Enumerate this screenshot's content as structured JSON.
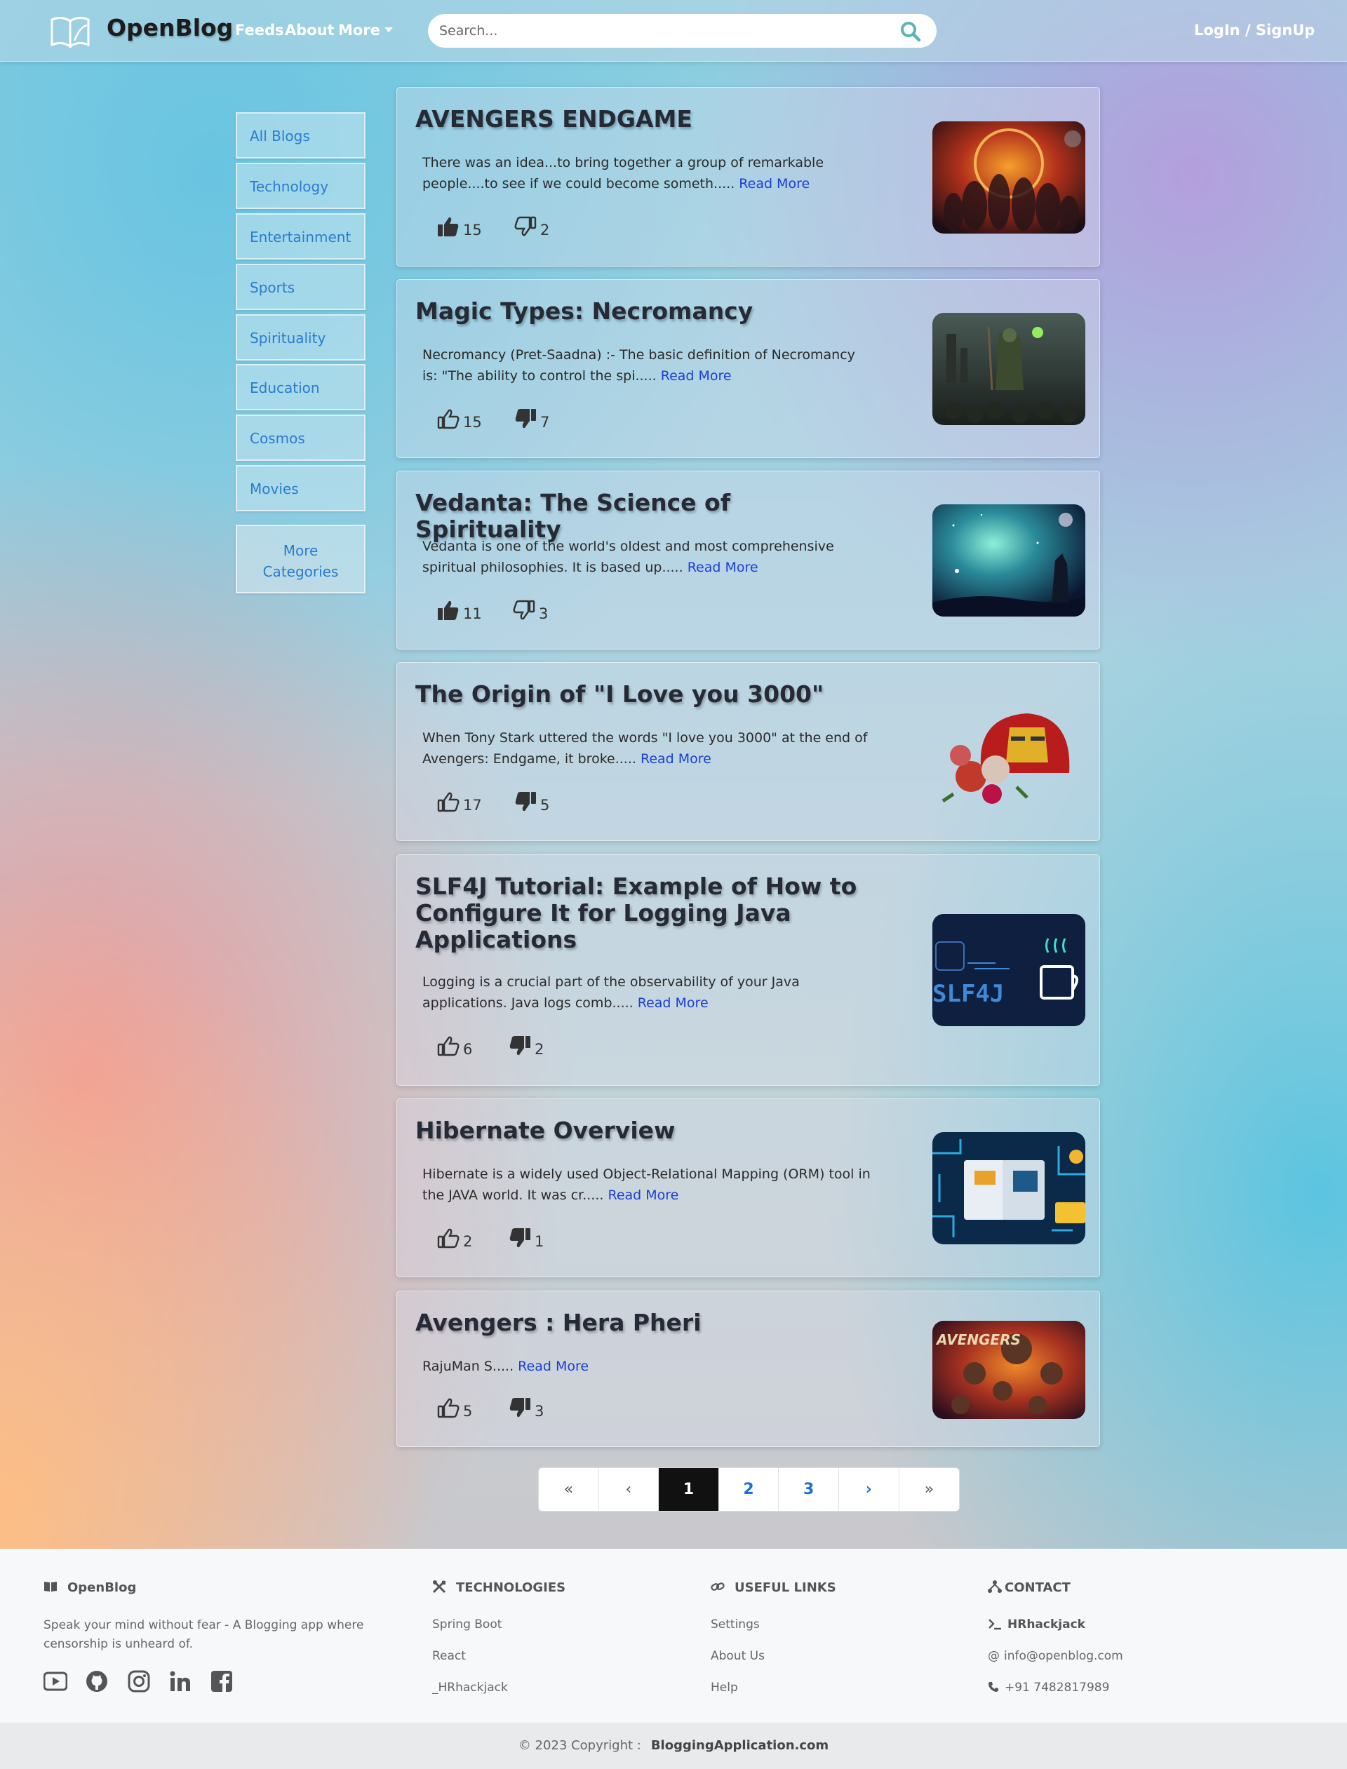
{
  "navbar": {
    "brand": "OpenBlog",
    "links": [
      "Feeds",
      "About",
      "More"
    ],
    "search_placeholder": "Search...",
    "login": "LogIn / SignUp"
  },
  "sidebar": {
    "categories": [
      "All Blogs",
      "Technology",
      "Entertainment",
      "Sports",
      "Spirituality",
      "Education",
      "Cosmos",
      "Movies"
    ],
    "more_line1": "More",
    "more_line2": "Categories"
  },
  "posts": [
    {
      "title": "AVENGERS ENDGAME",
      "excerpt": "There was an idea...to bring together a group of remarkable people....to see if we could become someth.....",
      "read_more": "Read More",
      "likes": "15",
      "dislikes": "2",
      "liked": true,
      "disliked": false,
      "image_icon": "avengers-poster"
    },
    {
      "title": "Magic Types: Necromancy",
      "excerpt": "Necromancy (Pret-Saadna) :- The basic definition of Necromancy is: \"The ability to control the spi.....",
      "read_more": "Read More",
      "likes": "15",
      "dislikes": "7",
      "liked": false,
      "disliked": true,
      "image_icon": "necromancer-art"
    },
    {
      "title": "Vedanta: The Science of Spirituality",
      "excerpt": "Vedanta is one of the world's oldest and most comprehensive spiritual philosophies. It is based up.....",
      "read_more": "Read More",
      "likes": "11",
      "dislikes": "3",
      "liked": true,
      "disliked": false,
      "image_icon": "cosmos-art"
    },
    {
      "title": "The Origin of \"I Love you 3000\"",
      "excerpt": "When Tony Stark uttered the words \"I love you 3000\" at the end of Avengers: Endgame, it broke.....",
      "read_more": "Read More",
      "likes": "17",
      "dislikes": "5",
      "liked": false,
      "disliked": true,
      "image_icon": "ironman-helmet-roses"
    },
    {
      "title": "SLF4J Tutorial: Example of How to Configure It for Logging Java Applications",
      "excerpt": "Logging is a crucial part of the observability of your Java applications. Java logs comb.....",
      "read_more": "Read More",
      "likes": "6",
      "dislikes": "2",
      "liked": false,
      "disliked": true,
      "image_icon": "slf4j-banner",
      "image_text": "SLF4J"
    },
    {
      "title": "Hibernate Overview",
      "excerpt": "Hibernate is a widely used Object-Relational Mapping (ORM) tool in the JAVA world.  It was cr.....",
      "read_more": "Read More",
      "likes": "2",
      "dislikes": "1",
      "liked": false,
      "disliked": true,
      "image_icon": "circuit-art"
    },
    {
      "title": "Avengers : Hera Pheri",
      "excerpt": "RajuMan S.....",
      "read_more": "Read More",
      "likes": "5",
      "dislikes": "3",
      "liked": false,
      "disliked": true,
      "image_icon": "hera-pheri-poster",
      "image_text": "AVENGERS"
    }
  ],
  "pagination": {
    "first": "«",
    "prev": "‹",
    "pages": [
      "1",
      "2",
      "3"
    ],
    "next": "›",
    "last": "»",
    "current": "1"
  },
  "footer": {
    "brand": "OpenBlog",
    "tagline": "Speak your mind without fear - A Blogging app where censorship is unheard of.",
    "technologies": {
      "heading": "TECHNOLOGIES",
      "items": [
        "Spring Boot",
        "React",
        "_HRhackjack"
      ]
    },
    "useful_links": {
      "heading": "USEFUL LINKS",
      "items": [
        "Settings",
        "About Us",
        "Help"
      ]
    },
    "contact": {
      "heading": "CONTACT",
      "name": "HRhackjack",
      "email": "info@openblog.com",
      "phone": "+91 7482817989"
    },
    "social_icons": [
      "youtube-icon",
      "github-icon",
      "instagram-icon",
      "linkedin-icon",
      "facebook-icon"
    ],
    "copyright_prefix": "© 2023 Copyright :",
    "copyright_site": "BloggingApplication.com"
  },
  "colors": {
    "link": "#2a7bd0",
    "read_more": "#1a3ed8",
    "active_page": "#111111"
  }
}
